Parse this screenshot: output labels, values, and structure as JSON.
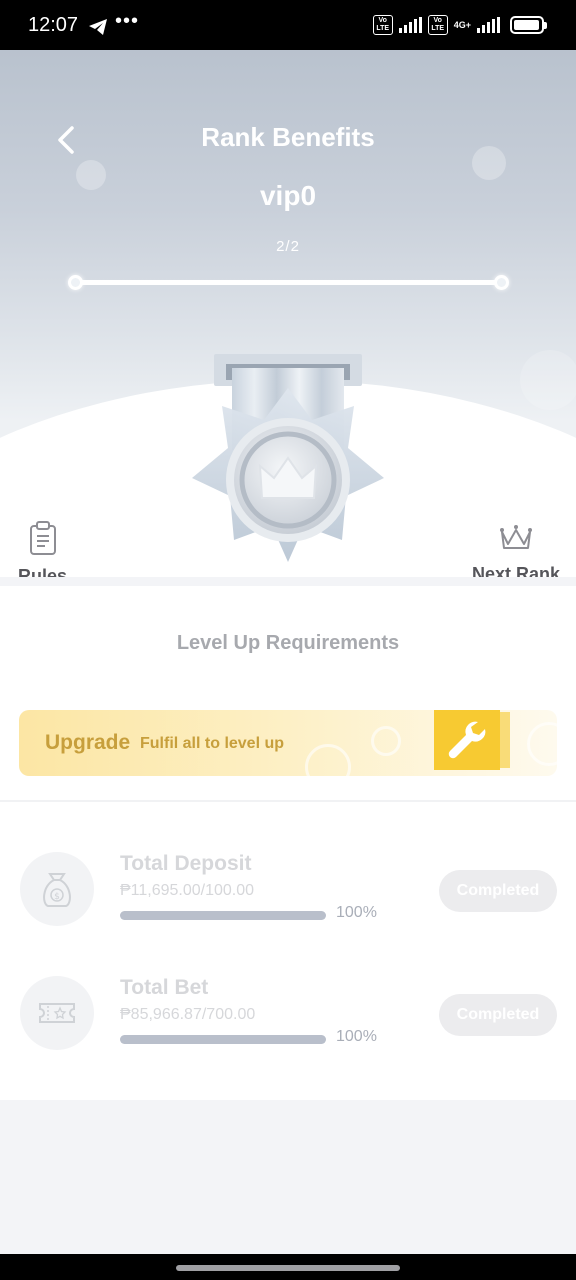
{
  "status_bar": {
    "time": "12:07",
    "dots": "•••",
    "volte1": "Vo LTE",
    "volte2": "Vo LTE",
    "network": "4G+"
  },
  "header": {
    "title": "Rank Benefits",
    "vip_level": "vip0",
    "page_indicator": "2/2"
  },
  "actions": {
    "rules_label": "Rules",
    "next_rank_label": "Next Rank"
  },
  "requirements": {
    "section_title": "Level Up Requirements",
    "upgrade_label": "Upgrade",
    "upgrade_subtitle": "Fulfil all to level up",
    "items": [
      {
        "name": "Total Deposit",
        "value": "₱11,695.00/100.00",
        "percent": "100%",
        "progress": 1.0,
        "status": "Completed",
        "icon": "money-bag-icon"
      },
      {
        "name": "Total Bet",
        "value": "₱85,966.87/700.00",
        "percent": "100%",
        "progress": 1.0,
        "status": "Completed",
        "icon": "ticket-icon"
      }
    ]
  },
  "colors": {
    "hero_top": "#b9c2ce",
    "upgrade_gold": "#c79f3c",
    "wrench_yellow": "#f7ca32"
  }
}
